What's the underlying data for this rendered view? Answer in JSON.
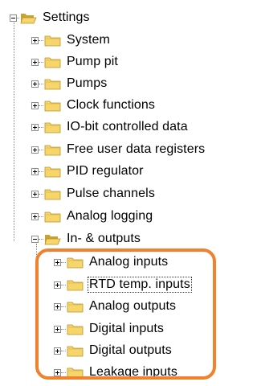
{
  "tree": {
    "root": {
      "label": "Settings",
      "expanded": true,
      "children": [
        {
          "label": "System",
          "expanded": false
        },
        {
          "label": "Pump pit",
          "expanded": false
        },
        {
          "label": "Pumps",
          "expanded": false
        },
        {
          "label": "Clock functions",
          "expanded": false
        },
        {
          "label": "IO-bit controlled data",
          "expanded": false
        },
        {
          "label": "Free user data registers",
          "expanded": false
        },
        {
          "label": "PID regulator",
          "expanded": false
        },
        {
          "label": "Pulse channels",
          "expanded": false
        },
        {
          "label": "Analog logging",
          "expanded": false
        },
        {
          "label": "In- & outputs",
          "expanded": true,
          "children": [
            {
              "label": "Analog inputs",
              "expanded": false
            },
            {
              "label": "RTD temp. inputs",
              "expanded": false,
              "focused": true
            },
            {
              "label": "Analog outputs",
              "expanded": false
            },
            {
              "label": "Digital inputs",
              "expanded": false
            },
            {
              "label": "Digital outputs",
              "expanded": false
            },
            {
              "label": "Leakage inputs",
              "expanded": false
            }
          ]
        }
      ]
    }
  },
  "colors": {
    "folder_fill": "#f6d66a",
    "folder_dark": "#c9a233",
    "highlight": "#f0822e",
    "connector": "#8c8c8c"
  },
  "icons": {
    "expander_collapsed": "plus-box",
    "expander_expanded": "minus-box",
    "folder_closed": "folder-icon",
    "folder_open": "folder-open-icon"
  }
}
